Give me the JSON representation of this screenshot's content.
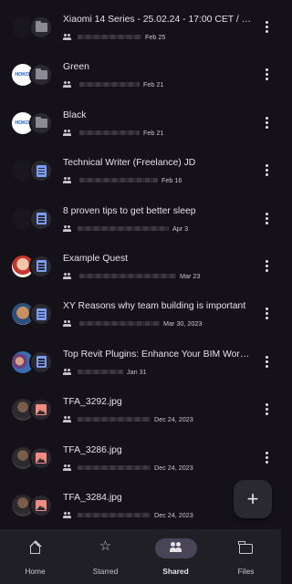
{
  "files": [
    {
      "title": "Xiaomi 14 Series - 25.02.24 - 17:00 CET / 16:...",
      "date": "Feb 25",
      "type": "folder",
      "owner": "ghost"
    },
    {
      "title": "Green",
      "date": "Feb 21",
      "type": "folder",
      "owner": "hokos",
      "owner_text": "HOKOS"
    },
    {
      "title": "Black",
      "date": "Feb 21",
      "type": "folder",
      "owner": "hokos",
      "owner_text": "HOKOS"
    },
    {
      "title": "Technical Writer (Freelance) JD",
      "date": "Feb 16",
      "type": "doc",
      "owner": "ghost"
    },
    {
      "title": "8 proven tips to get better sleep",
      "date": "Apr 3",
      "type": "doc",
      "owner": "ghost"
    },
    {
      "title": "Example Quest",
      "date": "Mar 23",
      "type": "doc",
      "owner": "photo-red"
    },
    {
      "title": "XY Reasons why team building is important",
      "date": "Mar 30, 2023",
      "type": "doc",
      "owner": "photo-face"
    },
    {
      "title": "Top Revit Plugins: Enhance Your BIM Workflo...",
      "date": "Jan 31",
      "type": "doc",
      "owner": "photo-group"
    },
    {
      "title": "TFA_3292.jpg",
      "date": "Dec 24, 2023",
      "type": "image",
      "owner": "photo-dark"
    },
    {
      "title": "TFA_3286.jpg",
      "date": "Dec 24, 2023",
      "type": "image",
      "owner": "photo-dark"
    },
    {
      "title": "TFA_3284.jpg",
      "date": "Dec 24, 2023",
      "type": "image",
      "owner": "photo-dark"
    }
  ],
  "fab": {
    "label": "+",
    "icon": "plus-icon"
  },
  "nav": [
    {
      "label": "Home",
      "icon": "home-icon",
      "active": false
    },
    {
      "label": "Starred",
      "icon": "star-icon",
      "active": false
    },
    {
      "label": "Shared",
      "icon": "people-icon",
      "active": true
    },
    {
      "label": "Files",
      "icon": "folder-icon",
      "active": false
    }
  ],
  "colors": {
    "background": "#141218",
    "nav_background": "#211f26",
    "active_pill": "#4a4458",
    "doc_icon": "#7a9ef5",
    "image_icon": "#f28b82"
  }
}
